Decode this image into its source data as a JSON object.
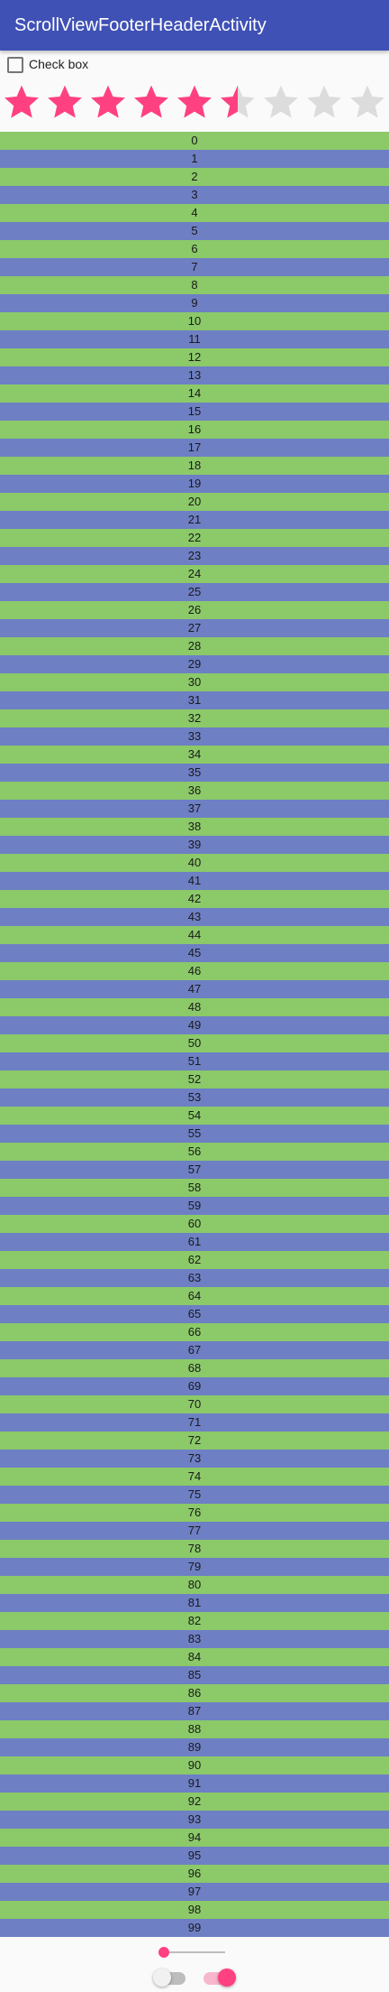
{
  "app": {
    "title": "ScrollViewFooterHeaderActivity"
  },
  "header": {
    "checkbox": {
      "label": "Check box",
      "checked": false
    },
    "rating": {
      "value": 5.5,
      "max": 9
    }
  },
  "list": {
    "items": [
      "0",
      "1",
      "2",
      "3",
      "4",
      "5",
      "6",
      "7",
      "8",
      "9",
      "10",
      "11",
      "12",
      "13",
      "14",
      "15",
      "16",
      "17",
      "18",
      "19",
      "20",
      "21",
      "22",
      "23",
      "24",
      "25",
      "26",
      "27",
      "28",
      "29",
      "30",
      "31",
      "32",
      "33",
      "34",
      "35",
      "36",
      "37",
      "38",
      "39",
      "40",
      "41",
      "42",
      "43",
      "44",
      "45",
      "46",
      "47",
      "48",
      "49",
      "50",
      "51",
      "52",
      "53",
      "54",
      "55",
      "56",
      "57",
      "58",
      "59",
      "60",
      "61",
      "62",
      "63",
      "64",
      "65",
      "66",
      "67",
      "68",
      "69",
      "70",
      "71",
      "72",
      "73",
      "74",
      "75",
      "76",
      "77",
      "78",
      "79",
      "80",
      "81",
      "82",
      "83",
      "84",
      "85",
      "86",
      "87",
      "88",
      "89",
      "90",
      "91",
      "92",
      "93",
      "94",
      "95",
      "96",
      "97",
      "98",
      "99"
    ]
  },
  "footer": {
    "seekbar": {
      "value": 0
    },
    "switch_off": {
      "checked": false
    },
    "switch_on": {
      "checked": true
    }
  },
  "colors": {
    "primary": "#3f51b5",
    "accent": "#ff4081",
    "row_even": "#8bc969",
    "row_odd": "#6e7fc4",
    "star_empty": "#dcdcdc"
  },
  "icons": {
    "star": "star-icon",
    "checkbox": "checkbox-icon"
  }
}
